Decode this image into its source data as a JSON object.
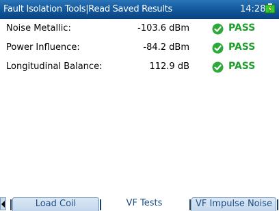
{
  "title_bar": {
    "title": "Fault Isolation Tools|Read Saved Results",
    "time": "14:28",
    "battery_icon": "battery-charging-icon",
    "battery_color": "#33cc33"
  },
  "results": [
    {
      "label": "Noise Metallic:",
      "value": "-103.6 dBm",
      "status": "PASS",
      "status_icon": "check-circle-icon"
    },
    {
      "label": "Power Influence:",
      "value": "-84.2 dBm",
      "status": "PASS",
      "status_icon": "check-circle-icon"
    },
    {
      "label": "Longitudinal Balance:",
      "value": "112.9 dB",
      "status": "PASS",
      "status_icon": "check-circle-icon"
    }
  ],
  "status_color": "#1e9e2b",
  "tabs": [
    {
      "label": "Load Coil",
      "active": false
    },
    {
      "label": "VF Tests",
      "active": true
    },
    {
      "label": "VF Impulse Noise",
      "active": false
    }
  ]
}
